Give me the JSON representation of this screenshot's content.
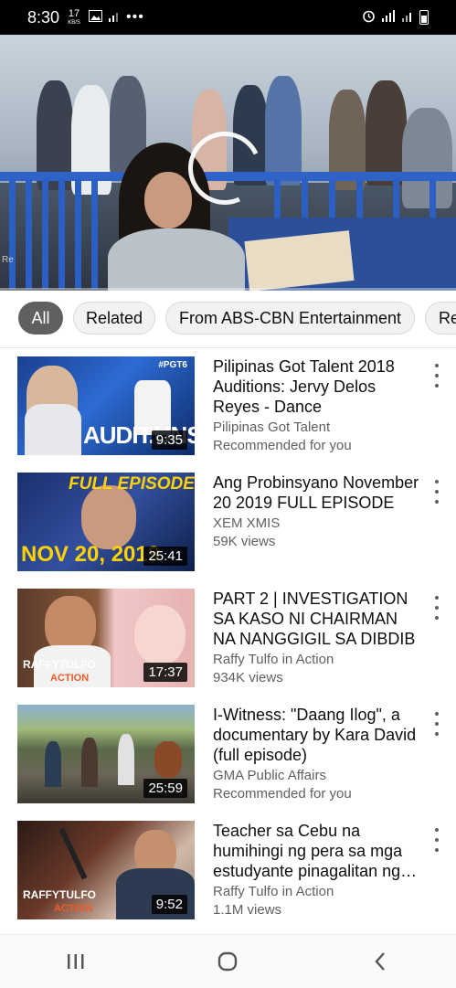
{
  "status_bar": {
    "time": "8:30",
    "net_speed_value": "17",
    "net_speed_unit": "KB/S"
  },
  "player": {
    "progress_fraction": 0.0,
    "watermark": "Re"
  },
  "chips": [
    "All",
    "Related",
    "From ABS-CBN Entertainment",
    "Re"
  ],
  "videos": [
    {
      "title": "Pilipinas Got Talent 2018 Auditions: Jervy Delos Reyes - Dance",
      "channel": "Pilipinas Got Talent",
      "meta": "Recommended for you",
      "duration": "9:35",
      "thumb_text": "AUDIT.UNS",
      "thumb_tag": "#PGT6"
    },
    {
      "title": "Ang Probinsyano November 20 2019 FULL EPISODE",
      "channel": "XEM XMIS",
      "meta": "59K views",
      "duration": "25:41",
      "thumb_text": "FULL EPISODE",
      "thumb_text2": "NOV 20, 2019"
    },
    {
      "title": "PART 2 | INVESTIGATION SA KASO NI CHAIRMAN NA NANGGIGIL SA DIBDIB",
      "channel": "Raffy Tulfo in Action",
      "meta": "934K views",
      "duration": "17:37",
      "thumb_text": "RAFFYTULFO",
      "thumb_text2": "ACTION"
    },
    {
      "title": "I-Witness: \"Daang Ilog\", a documentary by Kara David (full episode)",
      "channel": "GMA Public Affairs",
      "meta": "Recommended for you",
      "duration": "25:59"
    },
    {
      "title": "Teacher sa Cebu na humihingi ng pera sa mga estudyante pinagalitan ng Raffy Tulfo",
      "channel": "Raffy Tulfo in Action",
      "meta": "1.1M views",
      "duration": "9:52",
      "thumb_text": "RAFFYTULFO",
      "thumb_text2": "ACTION"
    }
  ],
  "colors": {
    "accent_red": "#ff0000",
    "chip_active": "#606060",
    "text_secondary": "#606060"
  },
  "icons": {
    "status": [
      "gallery-icon",
      "signal-icon",
      "more-dots-icon",
      "alarm-icon",
      "wifi-icon",
      "signal-icon",
      "battery-icon"
    ],
    "nav": [
      "recents-icon",
      "home-icon",
      "back-icon"
    ]
  }
}
